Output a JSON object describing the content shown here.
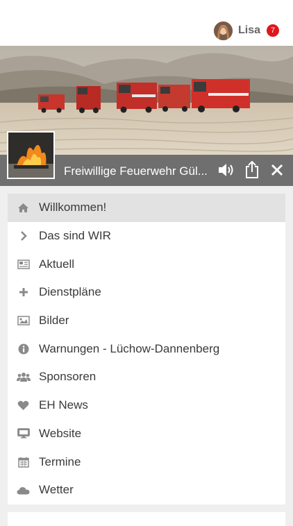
{
  "user": {
    "name": "Lisa",
    "notifications": "7"
  },
  "header": {
    "title": "Freiwillige Feuerwehr Gül..."
  },
  "menu": [
    {
      "label": "Willkommen!",
      "icon": "home-icon",
      "active": true
    },
    {
      "label": "Das sind WIR",
      "icon": "chevron-right-icon"
    },
    {
      "label": "Aktuell",
      "icon": "newspaper-icon"
    },
    {
      "label": "Dienstpläne",
      "icon": "plus-icon"
    },
    {
      "label": "Bilder",
      "icon": "image-icon"
    },
    {
      "label": "Warnungen - Lüchow-Dannenberg",
      "icon": "info-icon"
    },
    {
      "label": "Sponsoren",
      "icon": "group-icon"
    },
    {
      "label": "EH News",
      "icon": "heart-icon"
    },
    {
      "label": "Website",
      "icon": "monitor-icon"
    },
    {
      "label": "Termine",
      "icon": "calendar-icon"
    },
    {
      "label": "Wetter",
      "icon": "cloud-icon"
    }
  ],
  "colors": {
    "accent": "#e0161c",
    "titlebar": "#6f6f6f",
    "active_item": "#e2e2e2",
    "icon": "#8a8a8a"
  }
}
